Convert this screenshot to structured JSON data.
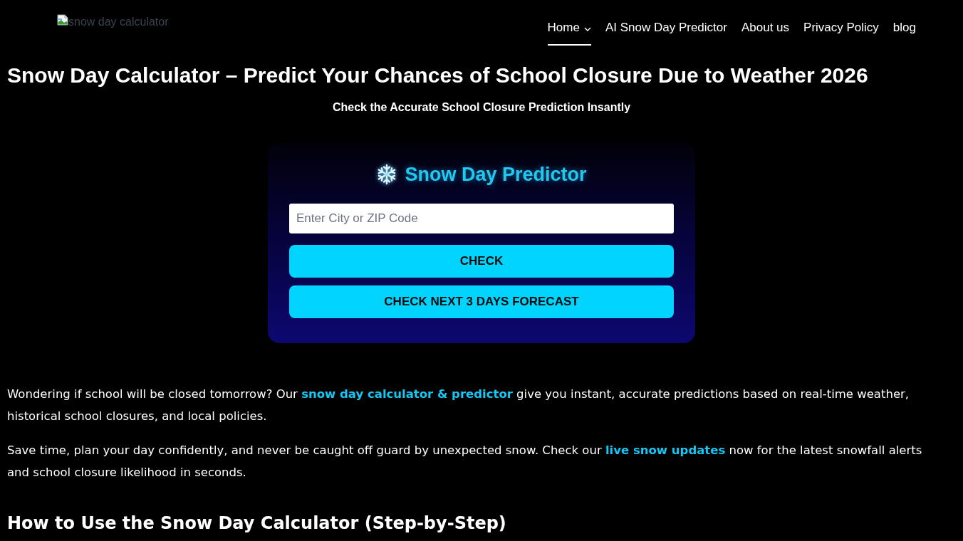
{
  "header": {
    "logo": {
      "alt_text": "snow day calculator"
    },
    "nav": [
      {
        "label": "Home",
        "selected": true,
        "has_dropdown": true
      },
      {
        "label": "AI Snow Day Predictor",
        "selected": false,
        "has_dropdown": false
      },
      {
        "label": "About us",
        "selected": false,
        "has_dropdown": false
      },
      {
        "label": "Privacy Policy",
        "selected": false,
        "has_dropdown": false
      },
      {
        "label": "blog",
        "selected": false,
        "has_dropdown": false
      }
    ]
  },
  "hero": {
    "title": "Snow Day Calculator – Predict Your Chances of School Closure Due to Weather 2026",
    "subtitle": "Check the Accurate School Closure Prediction Insantly"
  },
  "predictor": {
    "title": "Snow Day Predictor",
    "input": {
      "placeholder": "Enter City or ZIP Code"
    },
    "buttons": [
      "CHECK",
      "CHECK NEXT 3 DAYS FORECAST"
    ]
  },
  "intro": {
    "paragraphs": [
      [
        {
          "kind": "text",
          "text": "Wondering if school will be closed tomorrow? Our "
        },
        {
          "kind": "link",
          "text": "snow day calculator & predictor"
        },
        {
          "kind": "text",
          "text": " give you instant, accurate predictions based on real-time weather, historical school closures, and local policies."
        }
      ],
      [
        {
          "kind": "text",
          "text": "Save time, plan your day confidently, and never be caught off guard by unexpected snow. Check our "
        },
        {
          "kind": "link",
          "text": "live snow updates"
        },
        {
          "kind": "text",
          "text": " now for the latest snowfall alerts and school closure likelihood in seconds."
        }
      ]
    ]
  },
  "section": {
    "heading": "How to Use the Snow Day Calculator (Step-by-Step)"
  }
}
